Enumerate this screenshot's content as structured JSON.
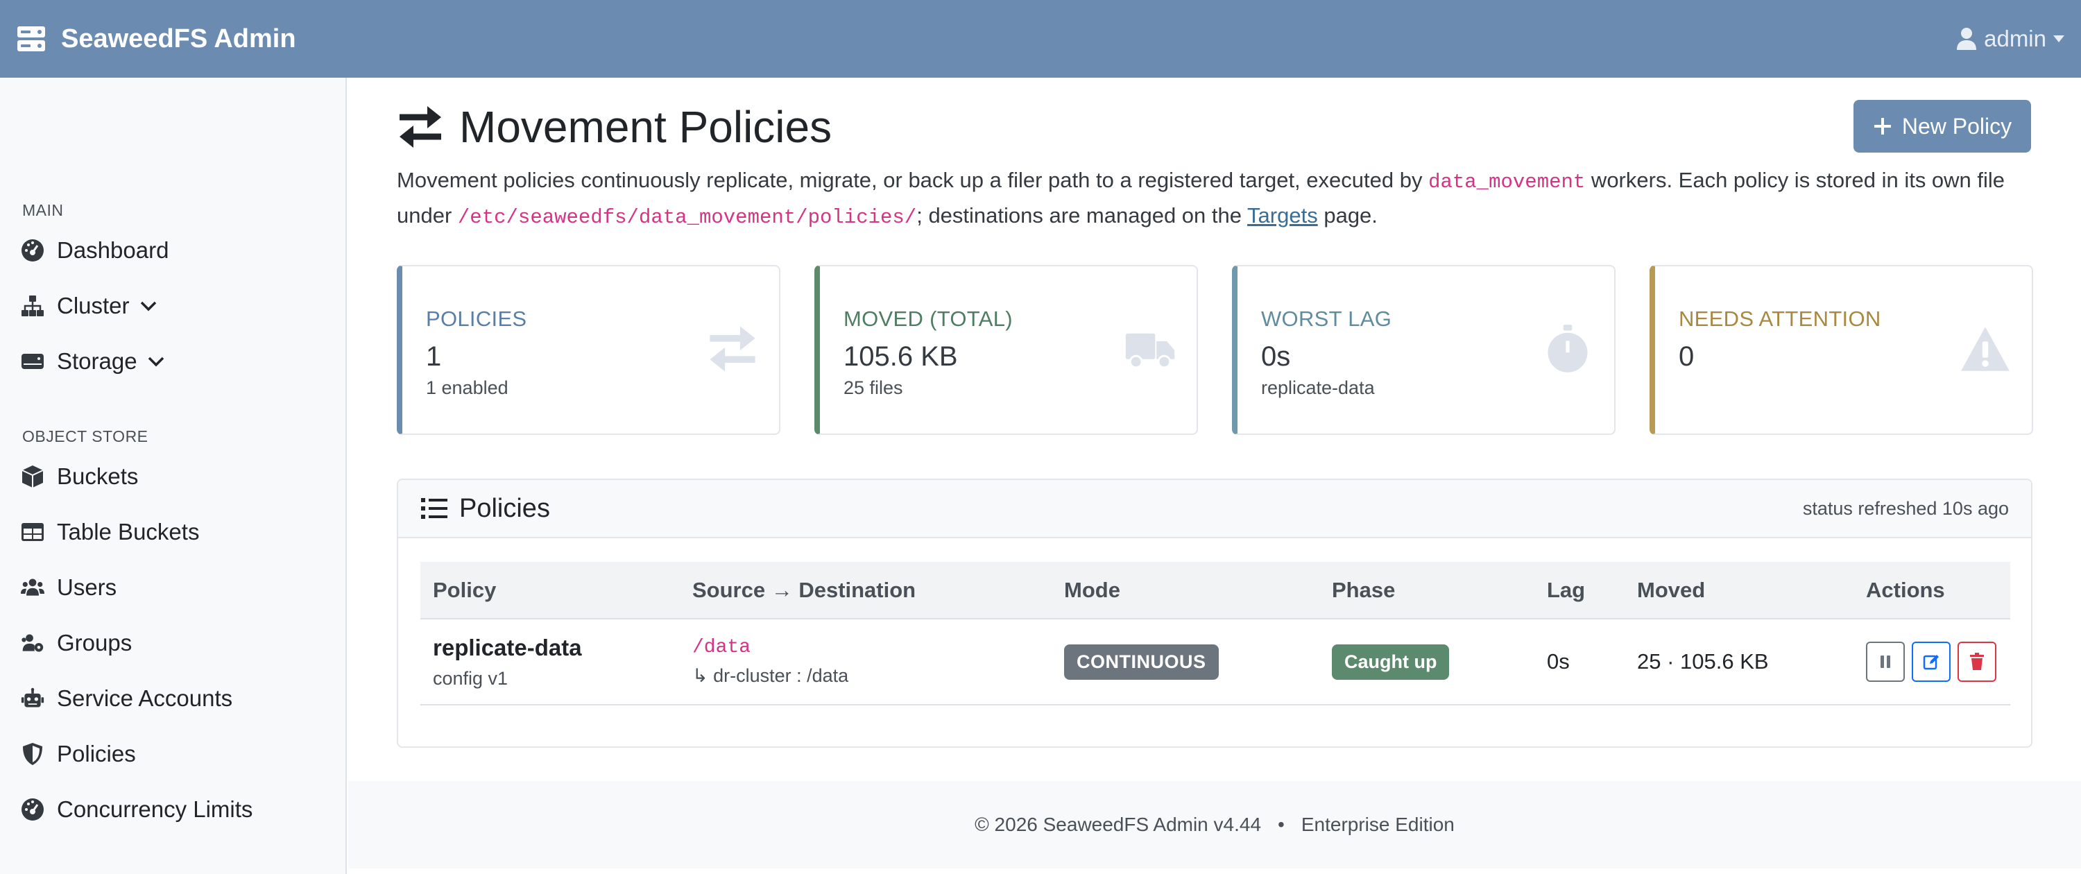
{
  "navbar": {
    "brand": "SeaweedFS Admin",
    "user": "admin",
    "brand_icon": "server-icon",
    "user_icon": "user-icon"
  },
  "sidebar": {
    "main_heading": "MAIN",
    "object_store_heading": "OBJECT STORE",
    "items": [
      {
        "label": "Dashboard",
        "icon": "dashboard-icon"
      },
      {
        "label": "Cluster",
        "icon": "sitemap-icon"
      },
      {
        "label": "Storage",
        "icon": "hdd-icon"
      },
      {
        "label": "Buckets",
        "icon": "cube-icon"
      },
      {
        "label": "Table Buckets",
        "icon": "table-icon"
      },
      {
        "label": "Users",
        "icon": "users-icon"
      },
      {
        "label": "Groups",
        "icon": "users-cog-icon"
      },
      {
        "label": "Service Accounts",
        "icon": "robot-icon"
      },
      {
        "label": "Policies",
        "icon": "shield-icon"
      },
      {
        "label": "Concurrency Limits",
        "icon": "gauge-icon"
      }
    ]
  },
  "page": {
    "title": "Movement Policies",
    "new_button": "New Policy",
    "desc_1": "Movement policies continuously replicate, migrate, or back up a filer path to a registered target, executed by ",
    "desc_code_1": "data_movement",
    "desc_2": " workers. Each policy is stored in its own file under ",
    "desc_code_2": "/etc/seaweedfs/data_movement/policies/",
    "desc_3": "; destinations are managed on the ",
    "desc_link": "Targets",
    "desc_4": " page."
  },
  "cards": [
    {
      "label": "POLICIES",
      "value": "1",
      "sub": "1 enabled",
      "color": "#6b8cb0",
      "icon": "exchange-icon"
    },
    {
      "label": "MOVED (TOTAL)",
      "value": "105.6 KB",
      "sub": "25 files",
      "color": "#5b8a6e",
      "icon": "truck-icon"
    },
    {
      "label": "WORST LAG",
      "value": "0s",
      "sub": "replicate-data",
      "color": "#6f9aae",
      "icon": "stopwatch-icon"
    },
    {
      "label": "NEEDS ATTENTION",
      "value": "0",
      "sub": "",
      "color": "#b89a54",
      "icon": "warning-icon"
    }
  ],
  "policies_panel": {
    "title": "Policies",
    "status": "status refreshed 10s ago",
    "columns": [
      "Policy",
      "Source → Destination",
      "Mode",
      "Phase",
      "Lag",
      "Moved",
      "Actions"
    ],
    "rows": [
      {
        "name": "replicate-data",
        "config": "config v1",
        "source": "/data",
        "destination": "↳ dr-cluster : /data",
        "mode": "CONTINUOUS",
        "phase": "Caught up",
        "lag": "0s",
        "moved": "25 · 105.6 KB"
      }
    ]
  },
  "footer": {
    "copyright": "© 2026 SeaweedFS Admin v4.44",
    "separator": "•",
    "edition": "Enterprise Edition"
  }
}
